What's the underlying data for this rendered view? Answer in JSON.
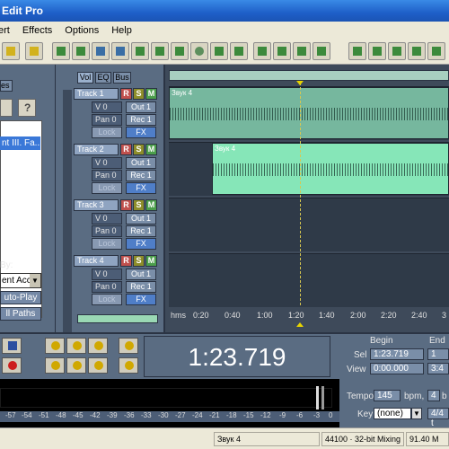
{
  "window": {
    "title": "Edit Pro"
  },
  "menu": {
    "items": [
      "ert",
      "Effects",
      "Options",
      "Help"
    ]
  },
  "left_panel": {
    "tab": "es",
    "selected_item": "nt III. Fa...",
    "by_label": "By:",
    "select_value": "ent Acc",
    "auto_play_label": "uto-Play",
    "paths_label": "ll Paths"
  },
  "track_tabs": [
    "Vol",
    "EQ",
    "Bus"
  ],
  "tracks": [
    {
      "name": "Track 1",
      "vol": "V 0",
      "pan": "Pan 0",
      "out": "Out 1",
      "rec": "Rec 1",
      "lock": "Lock",
      "fx": "FX"
    },
    {
      "name": "Track 2",
      "vol": "V 0",
      "pan": "Pan 0",
      "out": "Out 1",
      "rec": "Rec 1",
      "lock": "Lock",
      "fx": "FX"
    },
    {
      "name": "Track 3",
      "vol": "V 0",
      "pan": "Pan 0",
      "out": "Out 1",
      "rec": "Rec 1",
      "lock": "Lock",
      "fx": "FX"
    },
    {
      "name": "Track 4",
      "vol": "V 0",
      "pan": "Pan 0",
      "out": "Out 1",
      "rec": "Rec 1",
      "lock": "Lock",
      "fx": "FX"
    }
  ],
  "track_buttons": {
    "r": "R",
    "s": "S",
    "m": "M"
  },
  "clips": [
    {
      "label": "Звук 4",
      "color": "#76b79e"
    },
    {
      "label": "Звук 4",
      "color": "#86e6b8"
    }
  ],
  "ruler": {
    "labels": [
      "hms",
      "0:20",
      "0:40",
      "1:00",
      "1:20",
      "1:40",
      "2:00",
      "2:20",
      "2:40",
      "3"
    ]
  },
  "transport": {
    "time": "1:23.719"
  },
  "selection": {
    "begin_label": "Begin",
    "end_label": "End",
    "sel_label": "Sel",
    "view_label": "View",
    "sel_begin": "1:23.719",
    "view_begin": "0:00.000",
    "sel_end": "1",
    "view_end": "3:4"
  },
  "tempo": {
    "label": "Tempo",
    "value": "145",
    "unit": "bpm,",
    "beats": "4",
    "beats_unit": "b",
    "key_label": "Key",
    "key_value": "(none)",
    "time_sig": "4/4 t"
  },
  "meter_scale": [
    "-57",
    "-54",
    "-51",
    "-48",
    "-45",
    "-42",
    "-39",
    "-36",
    "-33",
    "-30",
    "-27",
    "-24",
    "-21",
    "-18",
    "-15",
    "-12",
    "-9",
    "-6",
    "-3",
    "0"
  ],
  "status": {
    "file": "Звук 4",
    "format": "44100 · 32-bit Mixing",
    "size": "91.40 M"
  },
  "colors": {
    "panel": "#5a6c82",
    "clip1": "#76b79e",
    "clip2": "#86e6b8",
    "cursor": "#e8d400"
  }
}
